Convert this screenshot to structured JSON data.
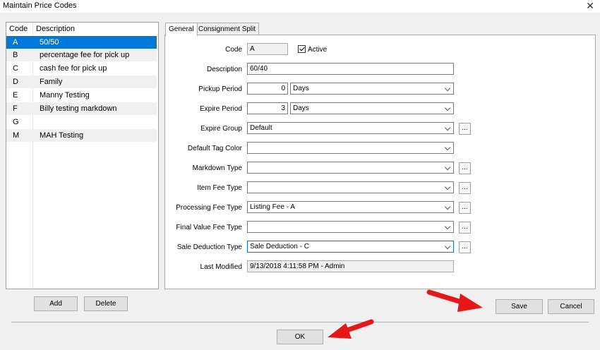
{
  "window": {
    "title": "Maintain Price Codes",
    "close_glyph": "✕"
  },
  "list": {
    "headers": {
      "code": "Code",
      "description": "Description"
    },
    "rows": [
      {
        "code": "A",
        "description": "50/50"
      },
      {
        "code": "B",
        "description": "percentage fee for pick up"
      },
      {
        "code": "C",
        "description": "cash fee for pick up"
      },
      {
        "code": "D",
        "description": "Family"
      },
      {
        "code": "E",
        "description": "Manny Testing"
      },
      {
        "code": "F",
        "description": "Billy testing markdown"
      },
      {
        "code": "G",
        "description": ""
      },
      {
        "code": "M",
        "description": "MAH Testing"
      }
    ],
    "selected_index": 0
  },
  "tabs": {
    "general": "General",
    "consignment": "Consignment Split"
  },
  "form": {
    "code_label": "Code",
    "code_value": "A",
    "active_label": "Active",
    "active_checked": true,
    "description_label": "Description",
    "description_value": "60/40",
    "pickup_label": "Pickup Period",
    "pickup_value": "0",
    "pickup_unit": "Days",
    "expire_label": "Expire Period",
    "expire_value": "3",
    "expire_unit": "Days",
    "expire_group_label": "Expire Group",
    "expire_group_value": "Default",
    "tag_color_label": "Default Tag Color",
    "tag_color_value": "",
    "markdown_label": "Markdown Type",
    "markdown_value": "",
    "item_fee_label": "Item Fee Type",
    "item_fee_value": "",
    "processing_label": "Processing Fee Type",
    "processing_value": "Listing Fee - A",
    "final_value_label": "Final Value Fee Type",
    "final_value_value": "",
    "sale_deduction_label": "Sale Deduction Type",
    "sale_deduction_value": "Sale Deduction - C",
    "last_modified_label": "Last Modified",
    "last_modified_value": "9/13/2018 4:11:58 PM - Admin",
    "ellipsis": "..."
  },
  "buttons": {
    "add": "Add",
    "delete": "Delete",
    "save": "Save",
    "cancel": "Cancel",
    "ok": "OK"
  },
  "colors": {
    "selection": "#0078d7",
    "arrow": "#e81717"
  }
}
